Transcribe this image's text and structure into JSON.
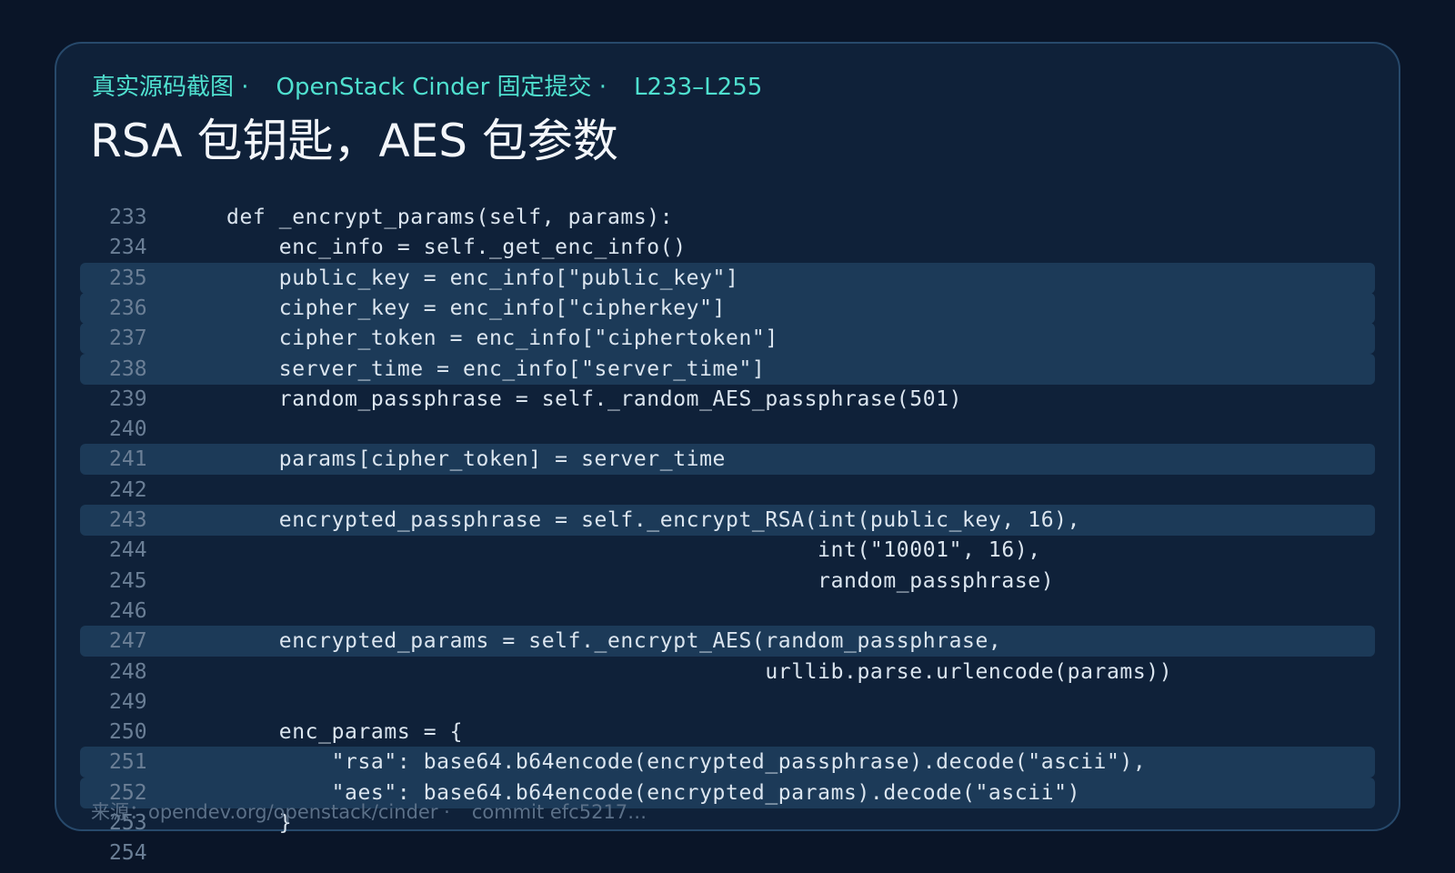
{
  "header": {
    "source_kind": "真实源码截图 ·",
    "repo": "OpenStack Cinder 固定提交 ·",
    "range": "L233–L255",
    "title": "RSA 包钥匙，AES 包参数"
  },
  "code": {
    "lines": [
      {
        "n": "233",
        "text": "def _encrypt_params(self, params):",
        "hl": false
      },
      {
        "n": "234",
        "text": "    enc_info = self._get_enc_info()",
        "hl": false
      },
      {
        "n": "235",
        "text": "    public_key = enc_info[\"public_key\"]",
        "hl": true
      },
      {
        "n": "236",
        "text": "    cipher_key = enc_info[\"cipherkey\"]",
        "hl": true
      },
      {
        "n": "237",
        "text": "    cipher_token = enc_info[\"ciphertoken\"]",
        "hl": true
      },
      {
        "n": "238",
        "text": "    server_time = enc_info[\"server_time\"]",
        "hl": true
      },
      {
        "n": "239",
        "text": "    random_passphrase = self._random_AES_passphrase(501)",
        "hl": false
      },
      {
        "n": "240",
        "text": "",
        "hl": false
      },
      {
        "n": "241",
        "text": "    params[cipher_token] = server_time",
        "hl": true
      },
      {
        "n": "242",
        "text": "",
        "hl": false
      },
      {
        "n": "243",
        "text": "    encrypted_passphrase = self._encrypt_RSA(int(public_key, 16),",
        "hl": true
      },
      {
        "n": "244",
        "text": "                                             int(\"10001\", 16),",
        "hl": false
      },
      {
        "n": "245",
        "text": "                                             random_passphrase)",
        "hl": false
      },
      {
        "n": "246",
        "text": "",
        "hl": false
      },
      {
        "n": "247",
        "text": "    encrypted_params = self._encrypt_AES(random_passphrase,",
        "hl": true
      },
      {
        "n": "248",
        "text": "                                         urllib.parse.urlencode(params))",
        "hl": false
      },
      {
        "n": "249",
        "text": "",
        "hl": false
      },
      {
        "n": "250",
        "text": "    enc_params = {",
        "hl": false
      },
      {
        "n": "251",
        "text": "        \"rsa\": base64.b64encode(encrypted_passphrase).decode(\"ascii\"),",
        "hl": true
      },
      {
        "n": "252",
        "text": "        \"aes\": base64.b64encode(encrypted_params).decode(\"ascii\")",
        "hl": true
      },
      {
        "n": "253",
        "text": "    }",
        "hl": false
      },
      {
        "n": "254",
        "text": "",
        "hl": false
      }
    ]
  },
  "footer": {
    "label": "来源：",
    "url": "opendev.org/openstack/cinder ·",
    "commit": "commit efc5217…"
  },
  "colors": {
    "accent": "#4fe0cf",
    "background": "#0a1528",
    "card": "#0f2139",
    "highlight": "#1c3a58"
  }
}
